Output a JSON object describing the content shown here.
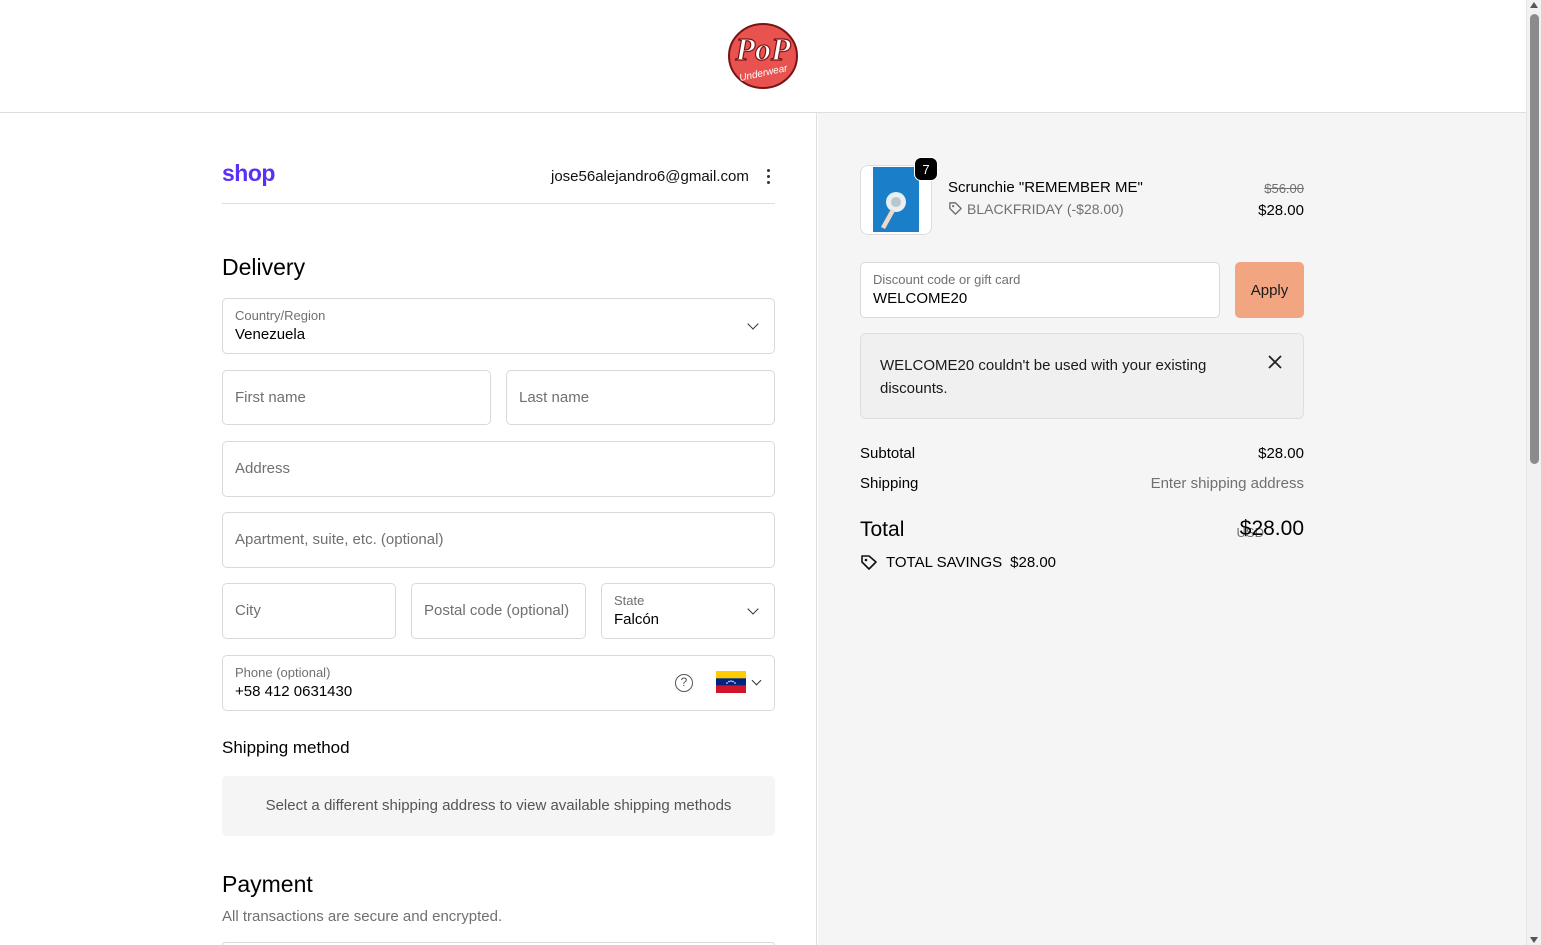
{
  "header": {
    "store_logo": "Pop Underwear"
  },
  "account": {
    "shop_logo": "shop",
    "email": "jose56alejandro6@gmail.com"
  },
  "delivery": {
    "heading": "Delivery",
    "country_label": "Country/Region",
    "country_value": "Venezuela",
    "first_name_placeholder": "First name",
    "last_name_placeholder": "Last name",
    "address_placeholder": "Address",
    "apartment_placeholder": "Apartment, suite, etc. (optional)",
    "city_placeholder": "City",
    "postal_placeholder": "Postal code (optional)",
    "state_label": "State",
    "state_value": "Falcón",
    "phone_label": "Phone (optional)",
    "phone_value": "+58 412 0631430",
    "phone_country_flag": "venezuela-flag"
  },
  "shipping_method": {
    "heading": "Shipping method",
    "message": "Select a different shipping address to view available shipping methods"
  },
  "payment": {
    "heading": "Payment",
    "note": "All transactions are secure and encrypted."
  },
  "order": {
    "item": {
      "name": "Scrunchie \"REMEMBER ME\"",
      "quantity": "7",
      "discount": "BLACKFRIDAY (-$28.00)",
      "original_price": "$56.00",
      "price": "$28.00"
    },
    "discount_label": "Discount code or gift card",
    "discount_value": "WELCOME20",
    "apply_label": "Apply",
    "error_message": "WELCOME20 couldn't be used with your existing discounts.",
    "subtotal_label": "Subtotal",
    "subtotal_value": "$28.00",
    "shipping_label": "Shipping",
    "shipping_value": "Enter shipping address",
    "total_label": "Total",
    "total_currency": "USD",
    "total_value": "$28.00",
    "savings_label": "TOTAL SAVINGS",
    "savings_value": "$28.00"
  },
  "colors": {
    "shop_brand": "#5a31f4",
    "apply_button": "#f2a581",
    "sidebar_bg": "#f5f5f5"
  }
}
